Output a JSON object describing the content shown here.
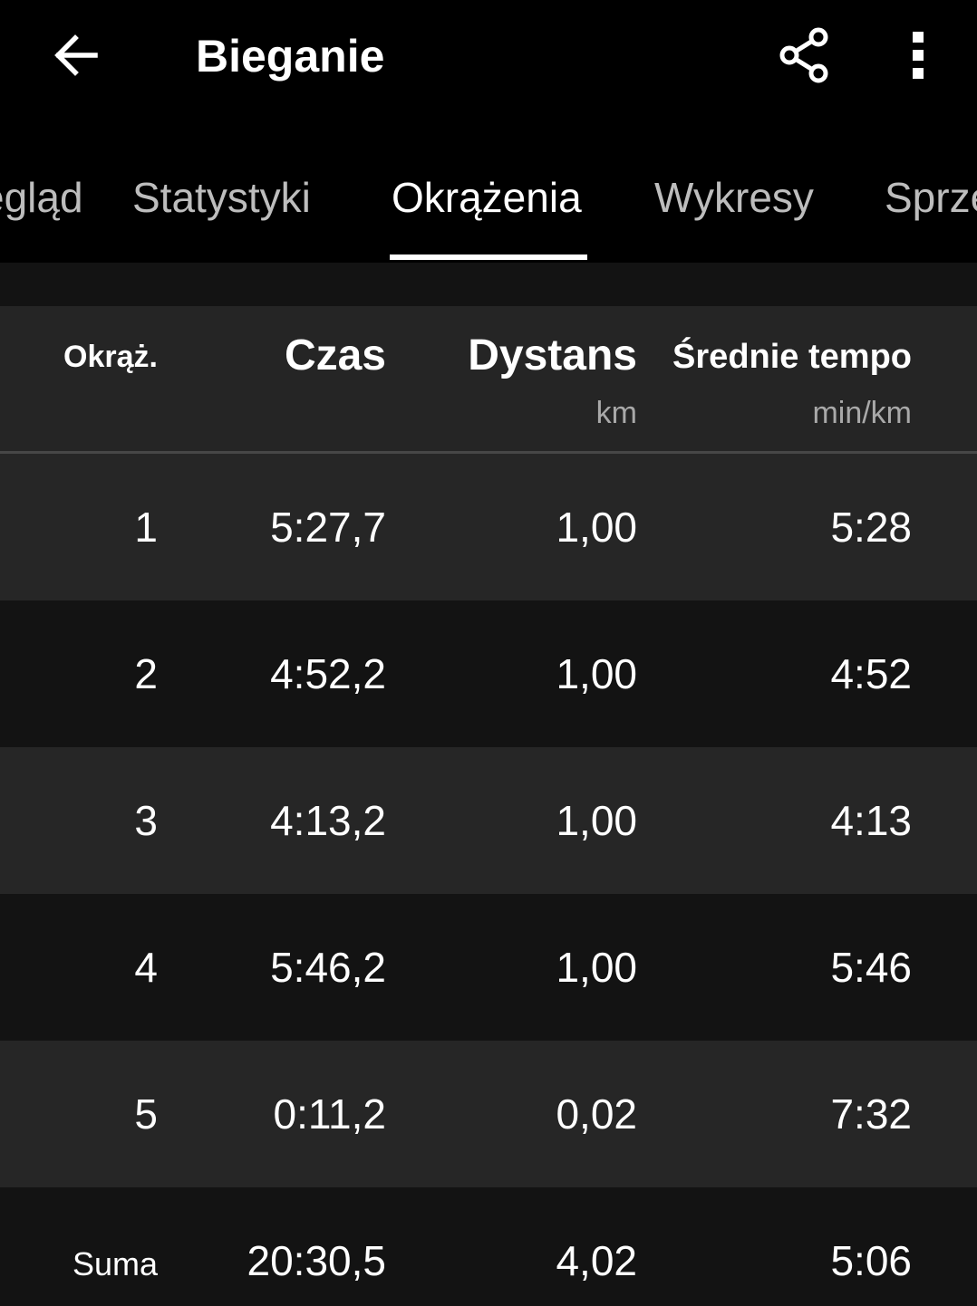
{
  "appbar": {
    "title": "Bieganie",
    "back_icon": "arrow-left-icon",
    "share_icon": "share-icon",
    "more_icon": "more-vertical-icon"
  },
  "tabs": [
    {
      "label": "Przegląd"
    },
    {
      "label": "Statystyki"
    },
    {
      "label": "Okrążenia",
      "active": true
    },
    {
      "label": "Wykresy"
    },
    {
      "label": "Sprzęt"
    }
  ],
  "table": {
    "headers": {
      "lap": "Okrąż.",
      "time": "Czas",
      "distance": "Dystans",
      "distance_unit": "km",
      "pace": "Średnie tempo",
      "pace_unit": "min/km"
    },
    "rows": [
      {
        "lap": "1",
        "time": "5:27,7",
        "distance": "1,00",
        "pace": "5:28"
      },
      {
        "lap": "2",
        "time": "4:52,2",
        "distance": "1,00",
        "pace": "4:52"
      },
      {
        "lap": "3",
        "time": "4:13,2",
        "distance": "1,00",
        "pace": "4:13"
      },
      {
        "lap": "4",
        "time": "5:46,2",
        "distance": "1,00",
        "pace": "5:46"
      },
      {
        "lap": "5",
        "time": "0:11,2",
        "distance": "0,02",
        "pace": "7:32"
      }
    ],
    "total": {
      "lap": "Suma",
      "time": "20:30,5",
      "distance": "4,02",
      "pace": "5:06"
    }
  },
  "colors": {
    "background": "#000000",
    "row_light": "#262626",
    "row_dark": "#131313",
    "text": "#ffffff",
    "tab_inactive": "#bdbdbd",
    "unit_text": "#a9a9a9"
  }
}
